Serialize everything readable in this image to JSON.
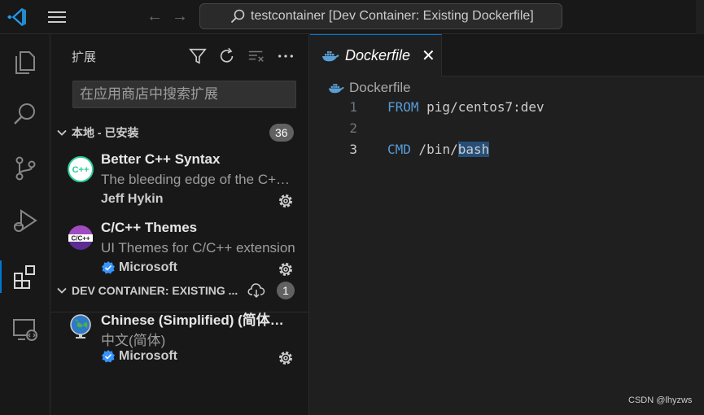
{
  "titlebar": {
    "command_center_text": "testcontainer [Dev Container: Existing Dockerfile]"
  },
  "activitybar": {
    "items": [
      "explorer-icon",
      "search-icon",
      "source-control-icon",
      "run-debug-icon",
      "extensions-icon",
      "remote-explorer-icon"
    ],
    "active": "extensions-icon"
  },
  "sidebar": {
    "title": "扩展",
    "search_placeholder": "在应用商店中搜索扩展",
    "sections": [
      {
        "title": "本地 - 已安装",
        "count": "36",
        "extensions": [
          {
            "name": "Better C++ Syntax",
            "description": "The bleeding edge of the C++ syntax",
            "publisher": "Jeff Hykin",
            "icon_text": "C++",
            "verified": false
          },
          {
            "name": "C/C++ Themes",
            "description": "UI Themes for C/C++ extension",
            "publisher": "Microsoft",
            "icon_text": "C/C++",
            "verified": true
          }
        ]
      },
      {
        "title": "DEV CONTAINER: EXISTING ...",
        "count": "1",
        "extensions": [
          {
            "name": "Chinese (Simplified) (简体中文)",
            "description": "中文(简体)",
            "publisher": "Microsoft",
            "icon_text": "",
            "verified": true
          }
        ]
      }
    ]
  },
  "editor": {
    "tab_label": "Dockerfile",
    "breadcrumb": "Dockerfile",
    "lines": [
      {
        "number": "1",
        "keyword": "FROM",
        "rest": " pig/centos7:dev",
        "highlight": ""
      },
      {
        "number": "2",
        "keyword": "",
        "rest": "",
        "highlight": ""
      },
      {
        "number": "3",
        "keyword": "CMD",
        "rest": " /bin/",
        "highlight": "bash"
      }
    ],
    "active_line": "3"
  },
  "watermark": "CSDN @lhyzws",
  "colors": {
    "accent": "#0078d4",
    "keyword": "#569cd6",
    "selection": "#264f78",
    "verified": "#3794ff"
  }
}
